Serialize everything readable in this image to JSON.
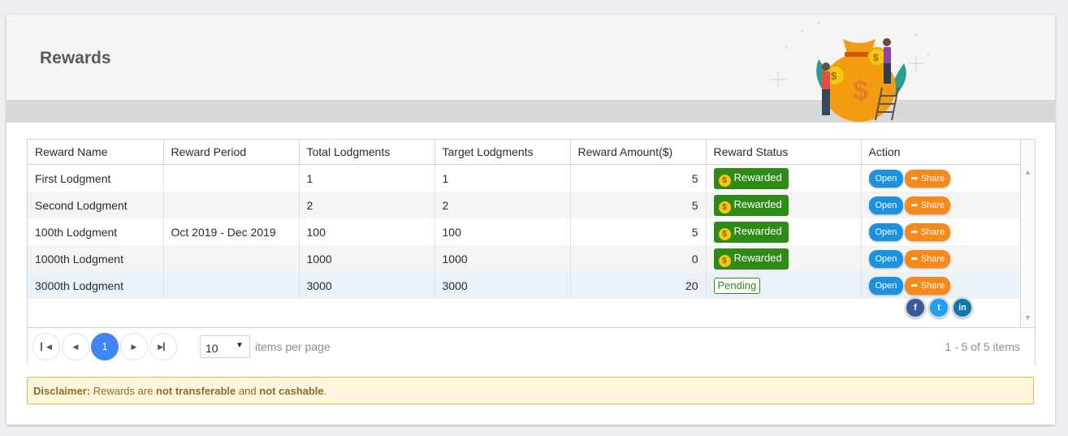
{
  "page": {
    "title": "Rewards"
  },
  "table": {
    "columns": [
      "Reward Name",
      "Reward Period",
      "Total Lodgments",
      "Target Lodgments",
      "Reward Amount($)",
      "Reward Status",
      "Action"
    ],
    "rows": [
      {
        "name": "First Lodgment",
        "period": "",
        "total": "1",
        "target": "1",
        "amount": "5",
        "status": "Rewarded"
      },
      {
        "name": "Second Lodgment",
        "period": "",
        "total": "2",
        "target": "2",
        "amount": "5",
        "status": "Rewarded"
      },
      {
        "name": "100th Lodgment",
        "period": "Oct 2019 - Dec 2019",
        "total": "100",
        "target": "100",
        "amount": "5",
        "status": "Rewarded"
      },
      {
        "name": "1000th Lodgment",
        "period": "",
        "total": "1000",
        "target": "1000",
        "amount": "0",
        "status": "Rewarded"
      },
      {
        "name": "3000th Lodgment",
        "period": "",
        "total": "3000",
        "target": "3000",
        "amount": "20",
        "status": "Pending"
      }
    ],
    "actions": {
      "open": "Open",
      "share": "Share"
    },
    "share_options": [
      "f",
      "t",
      "in"
    ]
  },
  "pager": {
    "current_page": "1",
    "page_size": "10",
    "items_per_page_label": "items per page",
    "info": "1 - 5 of 5 items"
  },
  "disclaimer": {
    "label": "Disclaimer:",
    "t1": " Rewards are ",
    "b1": "not transferable",
    "t2": " and ",
    "b2": "not cashable",
    "t3": "."
  },
  "colors": {
    "rewarded": "#2e8b17",
    "open_button": "#1b92e0",
    "share_button": "#f7891a",
    "active_page": "#3f85f5",
    "facebook": "#3b5998",
    "twitter": "#1da1f2",
    "linkedin": "#0e76a8"
  }
}
